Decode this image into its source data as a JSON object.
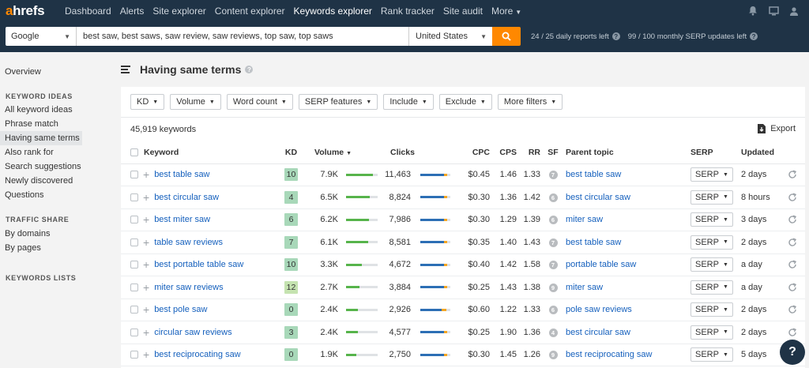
{
  "brand": {
    "logo_a": "a",
    "logo_rest": "hrefs",
    "accent": "#ff8800",
    "nav_bg": "#1f3346"
  },
  "nav": {
    "links": [
      "Dashboard",
      "Alerts",
      "Site explorer",
      "Content explorer",
      "Keywords explorer",
      "Rank tracker",
      "Site audit",
      "More"
    ],
    "active": "Keywords explorer",
    "right_icons": [
      "bell-icon",
      "monitor-icon",
      "user-icon"
    ]
  },
  "search": {
    "engine": "Google",
    "keywords": "best saw, best saws, saw review, saw reviews, top saw, top saws",
    "country": "United States",
    "daily_limit": "24 / 25 daily reports left",
    "serp_limit": "99 / 100 monthly SERP updates left"
  },
  "sidebar": {
    "overview": "Overview",
    "section_keyword_ideas": "KEYWORD IDEAS",
    "keyword_ideas": [
      "All keyword ideas",
      "Phrase match",
      "Having same terms",
      "Also rank for",
      "Search suggestions",
      "Newly discovered",
      "Questions"
    ],
    "selected": "Having same terms",
    "section_traffic": "TRAFFIC SHARE",
    "traffic": [
      "By domains",
      "By pages"
    ],
    "section_lists": "KEYWORDS LISTS"
  },
  "main": {
    "title": "Having same terms",
    "filters": [
      "KD",
      "Volume",
      "Word count",
      "SERP features",
      "Include",
      "Exclude",
      "More filters"
    ],
    "count": "45,919 keywords",
    "export": "Export",
    "columns": {
      "keyword": "Keyword",
      "kd": "KD",
      "volume": "Volume",
      "clicks": "Clicks",
      "cpc": "CPC",
      "cps": "CPS",
      "rr": "RR",
      "sf": "SF",
      "parent": "Parent topic",
      "serp": "SERP",
      "updated": "Updated"
    },
    "serp_label": "SERP"
  },
  "rows": [
    {
      "keyword": "best table saw",
      "kd": "10",
      "kd_color": "#a8d8b9",
      "volume": "7.9K",
      "volume_fill": 0.85,
      "clicks": "11,463",
      "clicks_org": 0.78,
      "clicks_paid": 0.12,
      "cpc": "$0.45",
      "cps": "1.46",
      "rr": "1.33",
      "sf": "7",
      "parent": "best table saw",
      "updated": "2 days"
    },
    {
      "keyword": "best circular saw",
      "kd": "4",
      "kd_color": "#a8d8b9",
      "volume": "6.5K",
      "volume_fill": 0.75,
      "clicks": "8,824",
      "clicks_org": 0.8,
      "clicks_paid": 0.1,
      "cpc": "$0.30",
      "cps": "1.36",
      "rr": "1.42",
      "sf": "6",
      "parent": "best circular saw",
      "updated": "8 hours"
    },
    {
      "keyword": "best miter saw",
      "kd": "6",
      "kd_color": "#a8d8b9",
      "volume": "6.2K",
      "volume_fill": 0.72,
      "clicks": "7,986",
      "clicks_org": 0.8,
      "clicks_paid": 0.1,
      "cpc": "$0.30",
      "cps": "1.29",
      "rr": "1.39",
      "sf": "6",
      "parent": "miter saw",
      "updated": "3 days"
    },
    {
      "keyword": "table saw reviews",
      "kd": "7",
      "kd_color": "#a8d8b9",
      "volume": "6.1K",
      "volume_fill": 0.7,
      "clicks": "8,581",
      "clicks_org": 0.78,
      "clicks_paid": 0.12,
      "cpc": "$0.35",
      "cps": "1.40",
      "rr": "1.43",
      "sf": "7",
      "parent": "best table saw",
      "updated": "2 days"
    },
    {
      "keyword": "best portable table saw",
      "kd": "10",
      "kd_color": "#a8d8b9",
      "volume": "3.3K",
      "volume_fill": 0.5,
      "clicks": "4,672",
      "clicks_org": 0.8,
      "clicks_paid": 0.1,
      "cpc": "$0.40",
      "cps": "1.42",
      "rr": "1.58",
      "sf": "7",
      "parent": "portable table saw",
      "updated": "a day"
    },
    {
      "keyword": "miter saw reviews",
      "kd": "12",
      "kd_color": "#c5e3b0",
      "volume": "2.7K",
      "volume_fill": 0.42,
      "clicks": "3,884",
      "clicks_org": 0.8,
      "clicks_paid": 0.1,
      "cpc": "$0.25",
      "cps": "1.43",
      "rr": "1.38",
      "sf": "9",
      "parent": "miter saw",
      "updated": "a day"
    },
    {
      "keyword": "best pole saw",
      "kd": "0",
      "kd_color": "#a8d8b9",
      "volume": "2.4K",
      "volume_fill": 0.38,
      "clicks": "2,926",
      "clicks_org": 0.72,
      "clicks_paid": 0.16,
      "cpc": "$0.60",
      "cps": "1.22",
      "rr": "1.33",
      "sf": "6",
      "parent": "pole saw reviews",
      "updated": "2 days"
    },
    {
      "keyword": "circular saw reviews",
      "kd": "3",
      "kd_color": "#a8d8b9",
      "volume": "2.4K",
      "volume_fill": 0.38,
      "clicks": "4,577",
      "clicks_org": 0.8,
      "clicks_paid": 0.1,
      "cpc": "$0.25",
      "cps": "1.90",
      "rr": "1.36",
      "sf": "4",
      "parent": "best circular saw",
      "updated": "2 days"
    },
    {
      "keyword": "best reciprocating saw",
      "kd": "0",
      "kd_color": "#a8d8b9",
      "volume": "1.9K",
      "volume_fill": 0.32,
      "clicks": "2,750",
      "clicks_org": 0.8,
      "clicks_paid": 0.1,
      "cpc": "$0.30",
      "cps": "1.45",
      "rr": "1.26",
      "sf": "9",
      "parent": "best reciprocating saw",
      "updated": "5 days"
    }
  ],
  "help_bubble": "?"
}
